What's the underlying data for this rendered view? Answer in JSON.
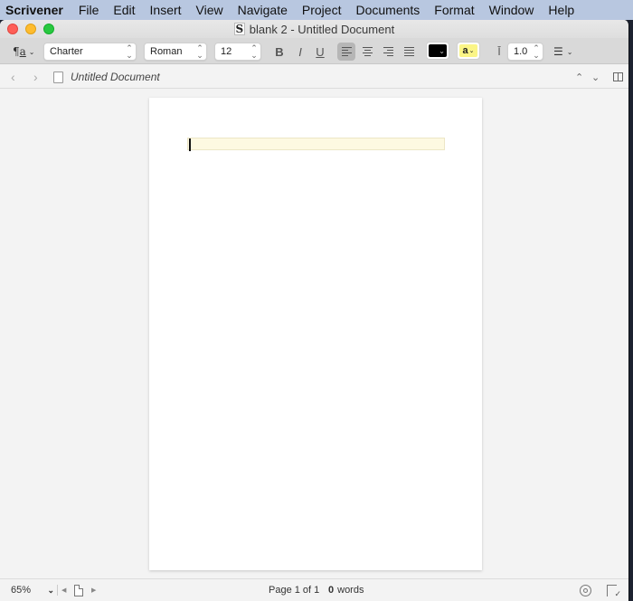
{
  "menubar": {
    "app_name": "Scrivener",
    "items": [
      "File",
      "Edit",
      "Insert",
      "View",
      "Navigate",
      "Project",
      "Documents",
      "Format",
      "Window",
      "Help"
    ]
  },
  "window": {
    "title": "blank 2 - Untitled Document",
    "title_icon": "scrivener-doc-icon"
  },
  "format_bar": {
    "paragraph_style_icon": "paragraph-style-icon",
    "font_family": "Charter",
    "font_style": "Roman",
    "font_size": "12",
    "bold_label": "B",
    "italic_label": "I",
    "underline_label": "U",
    "alignment_selected": "left",
    "alignments": [
      "left",
      "center",
      "right",
      "justify"
    ],
    "text_color": "#000000",
    "highlight_color": "#fbf586",
    "highlight_label": "a",
    "line_spacing": "1.0",
    "list_icon": "bullet-list-icon"
  },
  "navbar": {
    "document_title": "Untitled Document"
  },
  "editor": {
    "text": "",
    "line_highlight_color": "#fdf9e1"
  },
  "footer": {
    "zoom": "65%",
    "page_label": "Page 1 of 1",
    "word_count": "0",
    "word_label": "words"
  }
}
